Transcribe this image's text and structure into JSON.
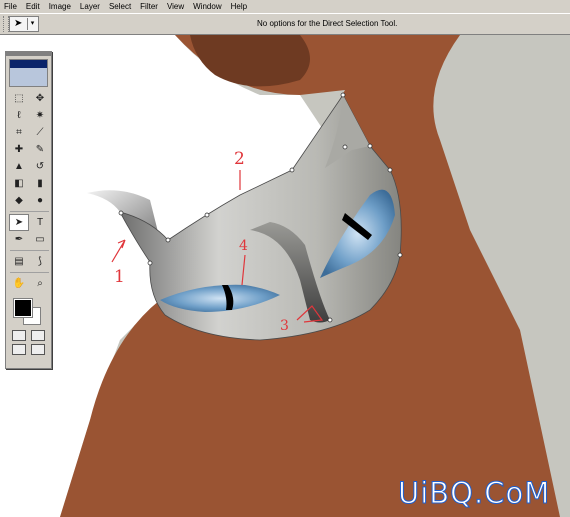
{
  "menu": [
    "File",
    "Edit",
    "Image",
    "Layer",
    "Select",
    "Filter",
    "View",
    "Window",
    "Help"
  ],
  "options": {
    "tool_preset_arrow": "▾",
    "message": "No options for the Direct Selection Tool."
  },
  "tools": [
    {
      "name": "marquee-tool",
      "glyph": "⬚"
    },
    {
      "name": "move-tool",
      "glyph": "✥"
    },
    {
      "name": "lasso-tool",
      "glyph": "ℓ"
    },
    {
      "name": "magic-wand-tool",
      "glyph": "✷"
    },
    {
      "name": "crop-tool",
      "glyph": "⌗"
    },
    {
      "name": "slice-tool",
      "glyph": "⟋"
    },
    {
      "name": "healing-brush-tool",
      "glyph": "✚"
    },
    {
      "name": "brush-tool",
      "glyph": "✎"
    },
    {
      "name": "clone-stamp-tool",
      "glyph": "▲"
    },
    {
      "name": "history-brush-tool",
      "glyph": "↺"
    },
    {
      "name": "eraser-tool",
      "glyph": "◧"
    },
    {
      "name": "gradient-tool",
      "glyph": "▮"
    },
    {
      "name": "blur-tool",
      "glyph": "◆"
    },
    {
      "name": "dodge-tool",
      "glyph": "●"
    },
    {
      "name": "direct-selection-tool",
      "glyph": "➤"
    },
    {
      "name": "type-tool",
      "glyph": "T"
    },
    {
      "name": "pen-tool",
      "glyph": "✒"
    },
    {
      "name": "shape-tool",
      "glyph": "▭"
    },
    {
      "name": "notes-tool",
      "glyph": "▤"
    },
    {
      "name": "eyedropper-tool",
      "glyph": "⟆"
    },
    {
      "name": "hand-tool",
      "glyph": "✋"
    },
    {
      "name": "zoom-tool",
      "glyph": "⌕"
    }
  ],
  "annotations": [
    "1",
    "2",
    "3",
    "4"
  ],
  "watermark": "UiBQ.CoM",
  "colors": {
    "ui": "#d4d0c8",
    "brown": "#9a5433",
    "dark_brown": "#6e3a22",
    "gray_bg": "#c6c6bf",
    "eye_blue": "#6f9fc8",
    "annotation_red": "#e0363b",
    "watermark_blue": "#1e5fd0"
  }
}
